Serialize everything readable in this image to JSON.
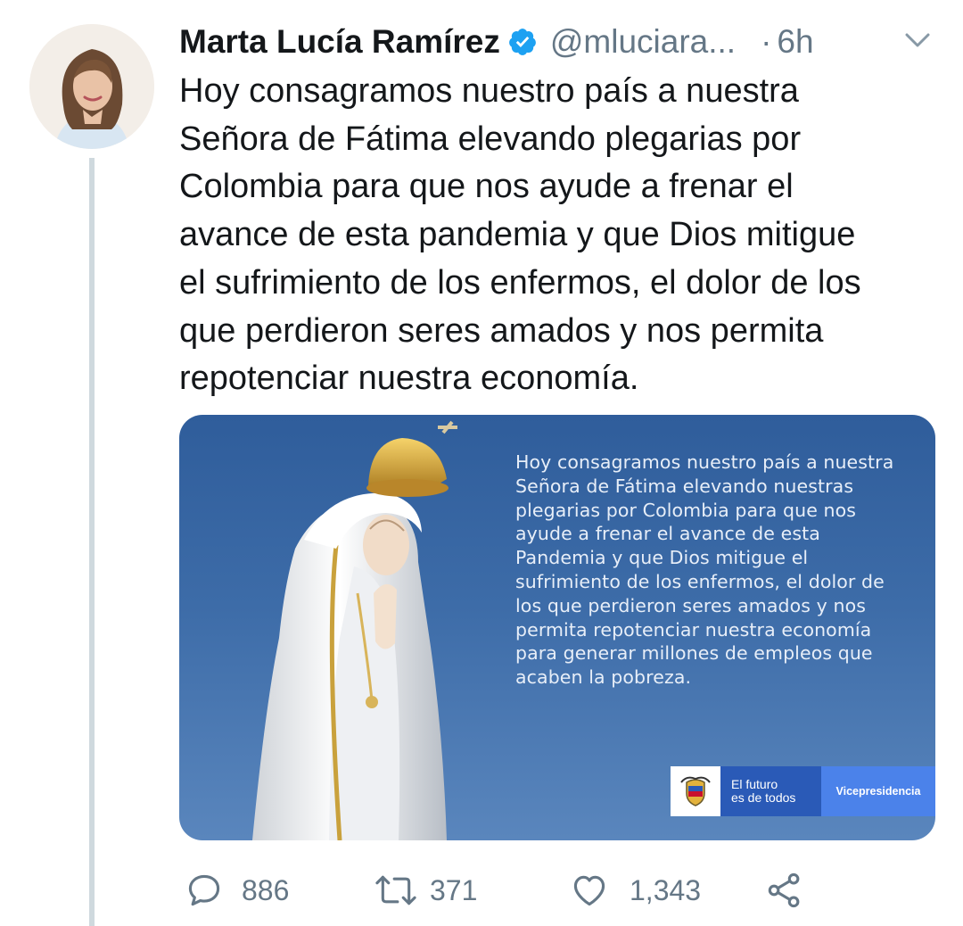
{
  "author": {
    "name": "Marta Lucía Ramírez",
    "handle": "@mluciara...",
    "separator": "·",
    "time": "6h"
  },
  "tweet": {
    "lines": [
      "Hoy consagramos nuestro país a nuestra",
      "Señora de Fátima elevando plegarias por",
      "Colombia para que nos ayude a frenar el",
      "avance de esta pandemia y que Dios mitigue",
      "el sufrimiento de los enfermos, el dolor de los",
      "que perdieron seres amados y nos permita",
      "repotenciar nuestra economía."
    ]
  },
  "media": {
    "text_lines": [
      "Hoy consagramos nuestro país a nuestra",
      "Señora de Fátima elevando nuestras",
      "plegarias por Colombia para que nos",
      "ayude a frenar el avance de esta",
      "Pandemia y que Dios mitigue el",
      "sufrimiento de los enfermos, el dolor de",
      "los que perdieron seres amados y nos",
      "permita repotenciar nuestra economía",
      "para generar millones de empleos que",
      "acaben la pobreza."
    ],
    "logo": {
      "future_line1": "El futuro",
      "future_line2": "es de todos",
      "office": "Vicepresidencia"
    }
  },
  "actions": {
    "replies": "886",
    "retweets": "371",
    "likes": "1,343"
  },
  "colors": {
    "accent": "#1da1f2",
    "text": "#14171a",
    "muted": "#657786",
    "thread_line": "#cfd9de",
    "logo_blue_dark": "#2a5ab7",
    "logo_blue_light": "#4b82ea"
  },
  "icons": [
    "verified-badge-icon",
    "chevron-down-icon",
    "reply-icon",
    "retweet-icon",
    "like-icon",
    "share-icon"
  ]
}
